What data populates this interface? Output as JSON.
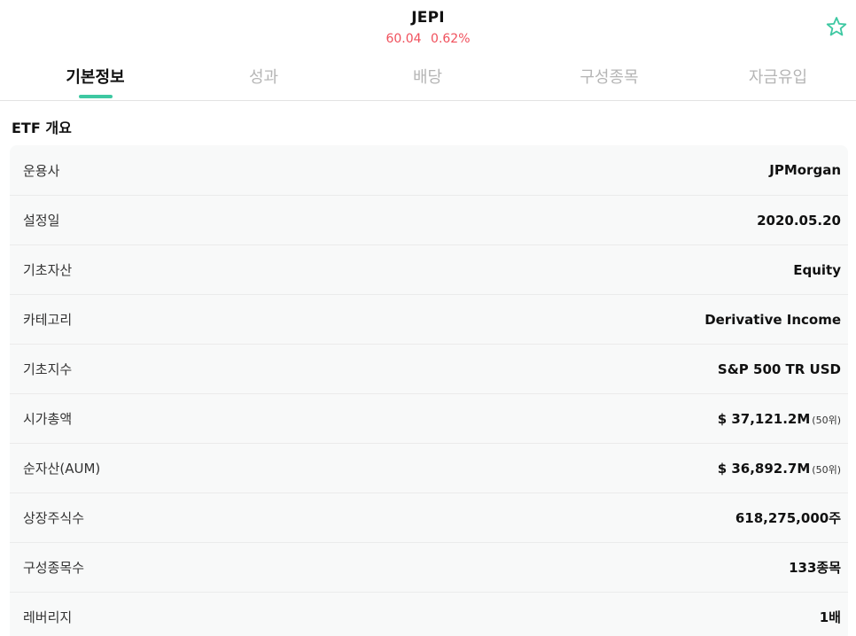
{
  "header": {
    "ticker": "JEPI",
    "price": "60.04",
    "change": "0.62%",
    "accent_color": "#f0505c",
    "favorite_icon": "star-outline-icon"
  },
  "tabs": [
    {
      "label": "기본정보",
      "active": true
    },
    {
      "label": "성과",
      "active": false
    },
    {
      "label": "배당",
      "active": false
    },
    {
      "label": "구성종목",
      "active": false
    },
    {
      "label": "자금유입",
      "active": false
    }
  ],
  "tab_indicator_color": "#3ec8a2",
  "overview": {
    "title": "ETF 개요",
    "rows": [
      {
        "label": "운용사",
        "value": "JPMorgan",
        "rank": ""
      },
      {
        "label": "설정일",
        "value": "2020.05.20",
        "rank": ""
      },
      {
        "label": "기초자산",
        "value": "Equity",
        "rank": ""
      },
      {
        "label": "카테고리",
        "value": "Derivative Income",
        "rank": ""
      },
      {
        "label": "기초지수",
        "value": "S&P 500 TR USD",
        "rank": ""
      },
      {
        "label": "시가총액",
        "value": "$ 37,121.2M",
        "rank": "(50위)"
      },
      {
        "label": "순자산(AUM)",
        "value": "$ 36,892.7M",
        "rank": "(50위)"
      },
      {
        "label": "상장주식수",
        "value": "618,275,000주",
        "rank": ""
      },
      {
        "label": "구성종목수",
        "value": "133종목",
        "rank": ""
      },
      {
        "label": "레버리지",
        "value": "1배",
        "rank": ""
      }
    ]
  }
}
